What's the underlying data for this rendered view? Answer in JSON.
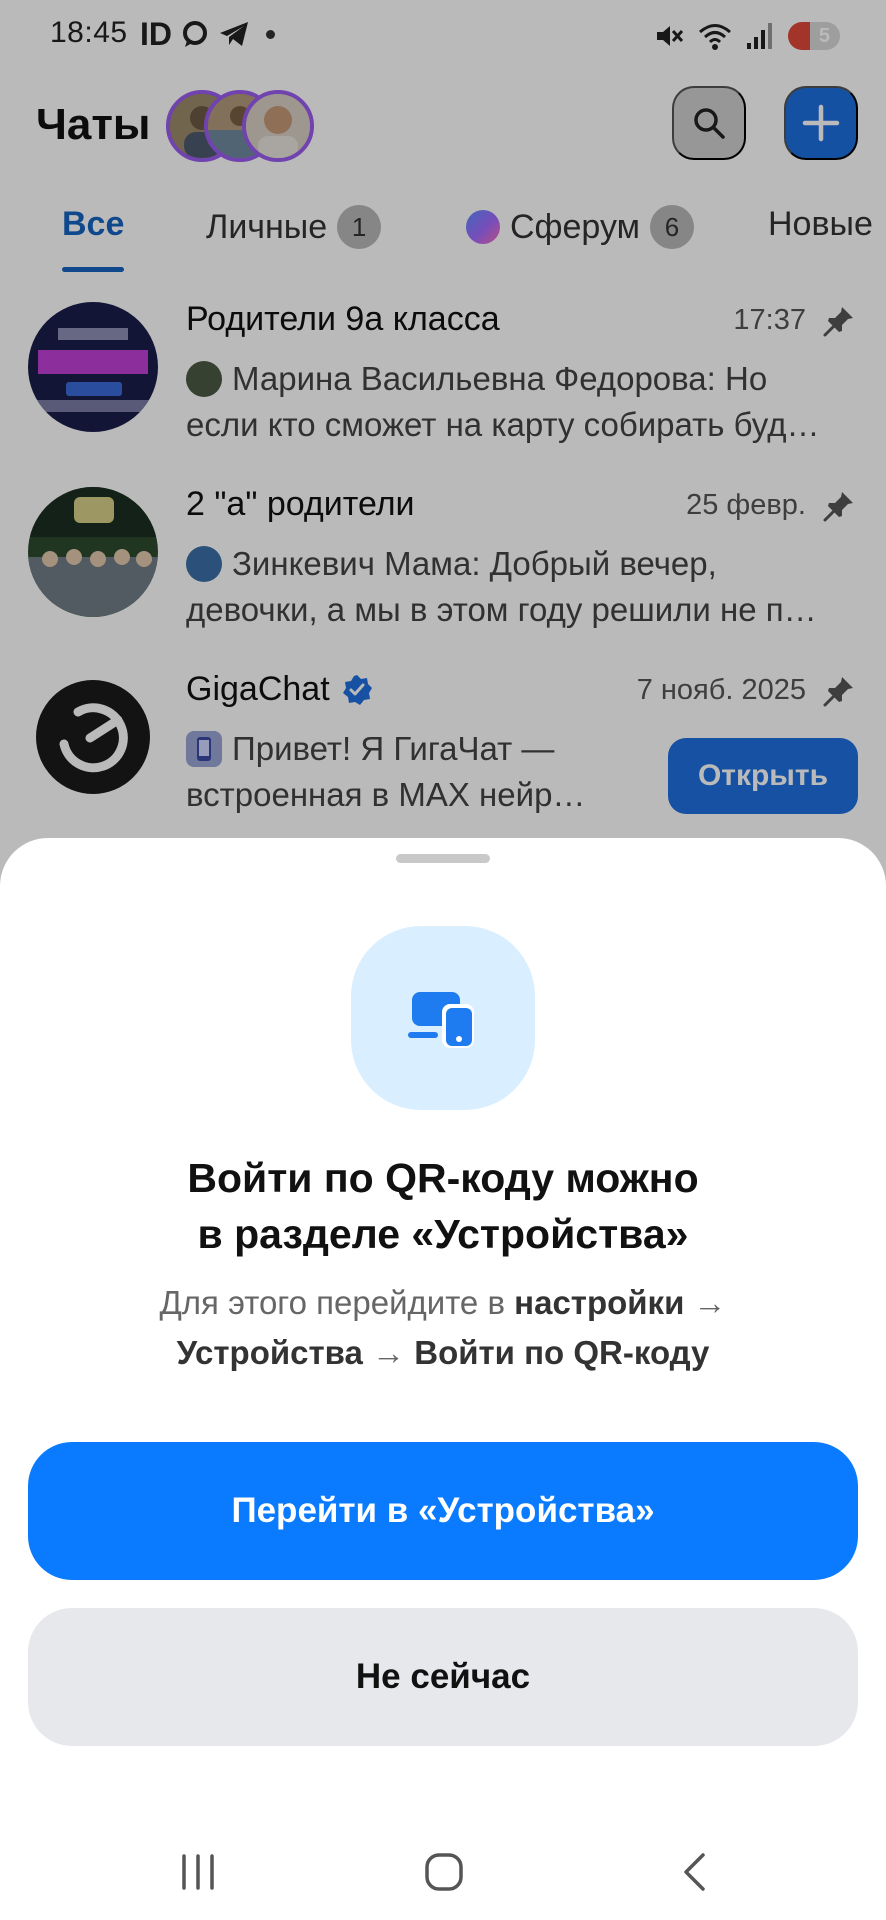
{
  "status_bar": {
    "time": "18:45",
    "id_label": "ID",
    "battery": "5"
  },
  "header": {
    "title": "Чаты"
  },
  "tabs": [
    {
      "label": "Все"
    },
    {
      "label": "Личные",
      "badge": "1"
    },
    {
      "label": "Сферум",
      "badge": "6"
    },
    {
      "label": "Новые"
    }
  ],
  "chats": [
    {
      "name": "Родители 9а класса",
      "time": "17:37",
      "preview_line1": "Марина Васильевна Федорова:  Но",
      "preview_line2": "если кто сможет на карту собирать буд…"
    },
    {
      "name": "2 \"а\" родители",
      "time": "25 февр.",
      "preview_line1": "Зинкевич Мама:  Добрый вечер,",
      "preview_line2": "девочки, а мы в этом году решили не п…"
    },
    {
      "name": "GigaChat",
      "time": "7 нояб. 2025",
      "preview_line1": "Привет! Я ГигаЧат —",
      "preview_line2": "встроенная в MAX нейр…",
      "action": "Открыть"
    }
  ],
  "sheet": {
    "title_line1": "Войти по QR-коду можно",
    "title_line2": "в разделе «Устройства»",
    "desc_prefix": "Для этого перейдите в ",
    "desc_settings": "настройки",
    "arrow": "→",
    "desc_devices": "Устройства",
    "desc_qr": "Войти по QR-коду",
    "primary_label": "Перейти в «Устройства»",
    "secondary_label": "Не сейчас"
  },
  "colors": {
    "accent": "#0a7bff",
    "tab_active": "#1565c0",
    "sheet_icon_bg": "#d9eeff"
  }
}
